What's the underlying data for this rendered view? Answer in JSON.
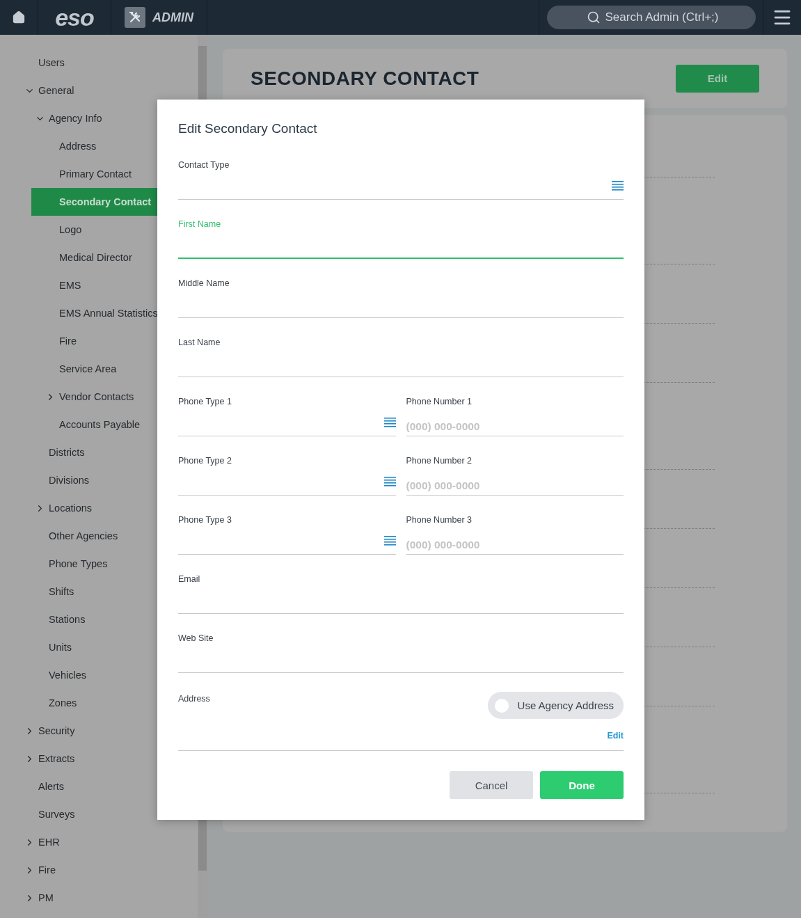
{
  "header": {
    "logo": "eso",
    "app_name": "ADMIN",
    "search": {
      "placeholder": "Search Admin (Ctrl+;)"
    }
  },
  "sidebar": {
    "items": [
      {
        "label": "Users",
        "selected": false
      },
      {
        "label": "General",
        "selected": false,
        "expanded": true,
        "children": [
          {
            "label": "Agency Info",
            "selected": false,
            "expanded": true,
            "children": [
              {
                "label": "Address",
                "selected": false
              },
              {
                "label": "Primary Contact",
                "selected": false
              },
              {
                "label": "Secondary Contact",
                "selected": true
              },
              {
                "label": "Logo",
                "selected": false
              },
              {
                "label": "Medical Director",
                "selected": false
              },
              {
                "label": "EMS",
                "selected": false
              },
              {
                "label": "EMS Annual Statistics",
                "selected": false
              },
              {
                "label": "Fire",
                "selected": false
              },
              {
                "label": "Service Area",
                "selected": false
              },
              {
                "label": "Vendor Contacts",
                "selected": false,
                "expanded": false
              },
              {
                "label": "Accounts Payable",
                "selected": false
              }
            ]
          },
          {
            "label": "Districts",
            "selected": false
          },
          {
            "label": "Divisions",
            "selected": false
          },
          {
            "label": "Locations",
            "selected": false,
            "expanded": false
          },
          {
            "label": "Other Agencies",
            "selected": false
          },
          {
            "label": "Phone Types",
            "selected": false
          },
          {
            "label": "Shifts",
            "selected": false
          },
          {
            "label": "Stations",
            "selected": false
          },
          {
            "label": "Units",
            "selected": false
          },
          {
            "label": "Vehicles",
            "selected": false
          },
          {
            "label": "Zones",
            "selected": false
          }
        ]
      },
      {
        "label": "Security",
        "selected": false,
        "expanded": false
      },
      {
        "label": "Extracts",
        "selected": false,
        "expanded": false
      },
      {
        "label": "Alerts",
        "selected": false
      },
      {
        "label": "Surveys",
        "selected": false
      },
      {
        "label": "EHR",
        "selected": false,
        "expanded": false
      },
      {
        "label": "Fire",
        "selected": false,
        "expanded": false
      },
      {
        "label": "PM",
        "selected": false,
        "expanded": false
      }
    ]
  },
  "page": {
    "title": "SECONDARY CONTACT",
    "edit_button": "Edit"
  },
  "modal": {
    "title": "Edit Secondary Contact",
    "fields": [
      {
        "kind": "select",
        "label": "Contact Type",
        "focused": false
      },
      {
        "kind": "text",
        "label": "First Name",
        "focused": true
      },
      {
        "kind": "text",
        "label": "Middle Name",
        "focused": false
      },
      {
        "kind": "text",
        "label": "Last Name",
        "focused": false
      },
      {
        "kind": "pair",
        "items": [
          {
            "kind": "select",
            "label": "Phone Type 1",
            "focused": false
          },
          {
            "kind": "text",
            "label": "Phone Number 1",
            "placeholder": "(000) 000-0000",
            "focused": false
          }
        ]
      },
      {
        "kind": "pair",
        "items": [
          {
            "kind": "select",
            "label": "Phone Type 2",
            "focused": false
          },
          {
            "kind": "text",
            "label": "Phone Number 2",
            "placeholder": "(000) 000-0000",
            "focused": false
          }
        ]
      },
      {
        "kind": "pair",
        "items": [
          {
            "kind": "select",
            "label": "Phone Type 3",
            "focused": false
          },
          {
            "kind": "text",
            "label": "Phone Number 3",
            "placeholder": "(000) 000-0000",
            "focused": false
          }
        ]
      },
      {
        "kind": "text",
        "label": "Email",
        "focused": false
      },
      {
        "kind": "text",
        "label": "Web Site",
        "focused": false
      }
    ],
    "address": {
      "label": "Address",
      "toggle": {
        "label": "Use Agency Address",
        "on": false
      },
      "link": "Edit"
    },
    "buttons": [
      {
        "kind": "secondary",
        "label": "Cancel"
      },
      {
        "kind": "primary",
        "label": "Done"
      }
    ]
  }
}
